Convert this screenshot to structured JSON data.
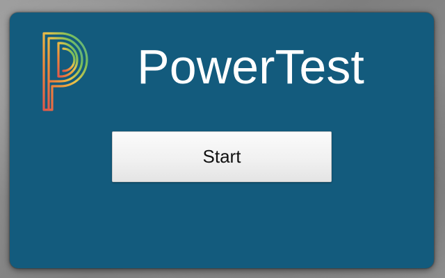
{
  "app": {
    "title": "PowerTest",
    "logo_icon": "powerschool-p-logo-icon"
  },
  "actions": {
    "start_label": "Start"
  },
  "colors": {
    "card_background": "#135b7d",
    "title_text": "#ffffff",
    "button_background": "#f1f1f1",
    "button_text": "#111111",
    "page_background": "#8f8f8f",
    "logo_colors": [
      "#e0584b",
      "#ef8a3a",
      "#e6c34a",
      "#7bbf5a",
      "#4aa7a0"
    ]
  }
}
